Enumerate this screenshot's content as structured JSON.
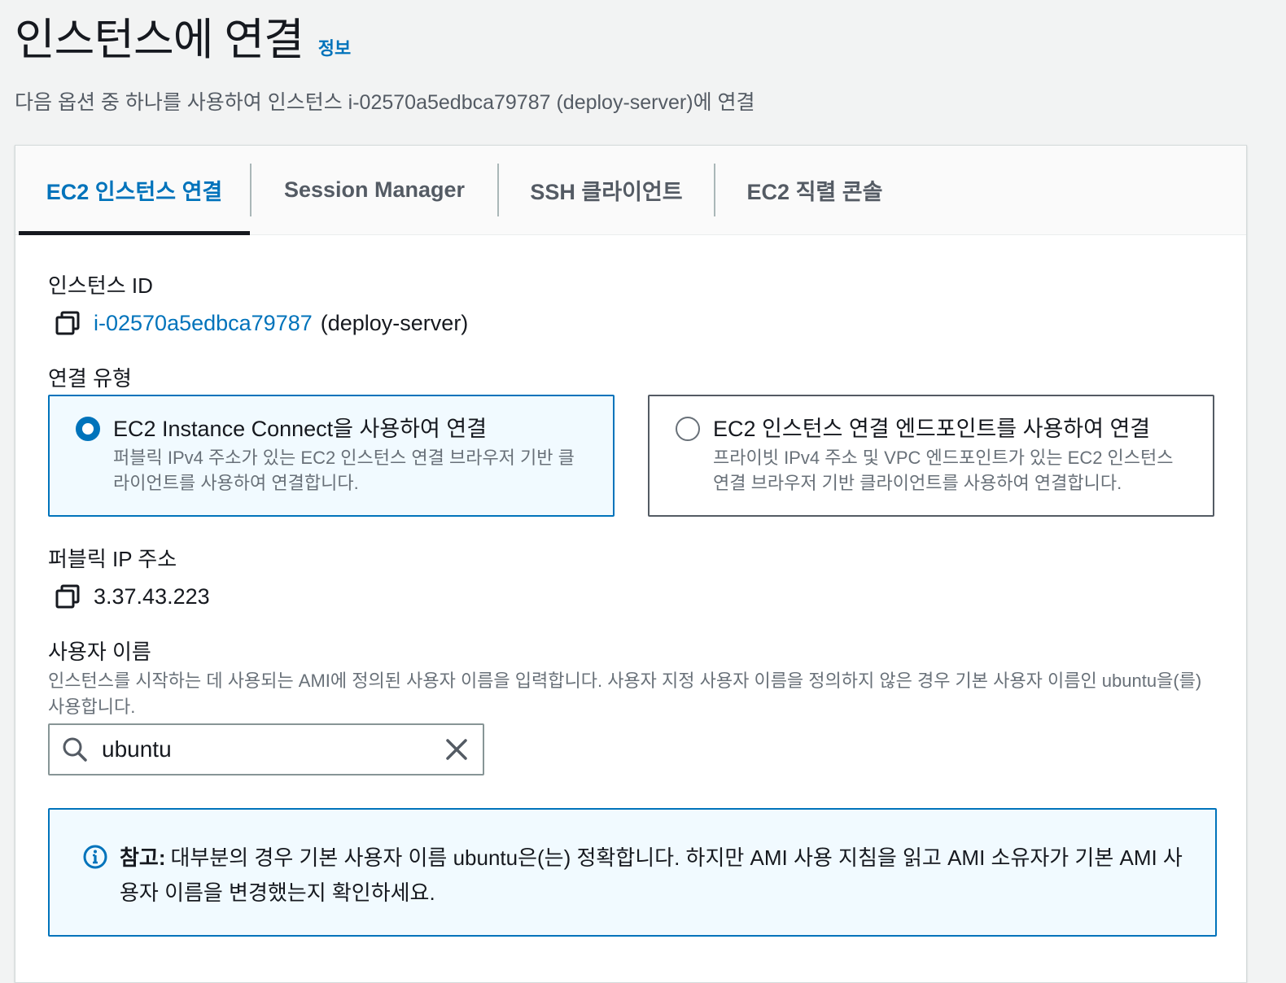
{
  "header": {
    "title": "인스턴스에 연결",
    "info_link": "정보",
    "subtitle": "다음 옵션 중 하나를 사용하여 인스턴스 i-02570a5edbca79787 (deploy-server)에 연결"
  },
  "tabs": [
    {
      "label": "EC2 인스턴스 연결",
      "active": true
    },
    {
      "label": "Session Manager",
      "active": false
    },
    {
      "label": "SSH 클라이언트",
      "active": false
    },
    {
      "label": "EC2 직렬 콘솔",
      "active": false
    }
  ],
  "instance": {
    "label": "인스턴스 ID",
    "id": "i-02570a5edbca79787",
    "name": "(deploy-server)"
  },
  "connection": {
    "label": "연결 유형",
    "options": [
      {
        "title": "EC2 Instance Connect을 사용하여 연결",
        "description": "퍼블릭 IPv4 주소가 있는 EC2 인스턴스 연결 브라우저 기반 클라이언트를 사용하여 연결합니다.",
        "selected": true
      },
      {
        "title": "EC2 인스턴스 연결 엔드포인트를 사용하여 연결",
        "description": "프라이빗 IPv4 주소 및 VPC 엔드포인트가 있는 EC2 인스턴스 연결 브라우저 기반 클라이언트를 사용하여 연결합니다.",
        "selected": false
      }
    ]
  },
  "public_ip": {
    "label": "퍼블릭 IP 주소",
    "value": "3.37.43.223"
  },
  "username": {
    "label": "사용자 이름",
    "description": "인스턴스를 시작하는 데 사용되는 AMI에 정의된 사용자 이름을 입력합니다. 사용자 지정 사용자 이름을 정의하지 않은 경우 기본 사용자 이름인 ubuntu을(를) 사용합니다.",
    "value": "ubuntu"
  },
  "alert": {
    "strong": "참고:",
    "text": "대부분의 경우 기본 사용자 이름 ubuntu은(는) 정확합니다. 하지만 AMI 사용 지침을 읽고 AMI 소유자가 기본 AMI 사용자 이름을 변경했는지 확인하세요."
  },
  "icons": {
    "copy": "copy-icon",
    "search": "search-icon",
    "clear": "close-icon",
    "info": "info-circle-icon"
  },
  "colors": {
    "accent": "#0073bb",
    "text": "#16191f",
    "muted": "#687078",
    "info_bg": "#f1faff"
  }
}
